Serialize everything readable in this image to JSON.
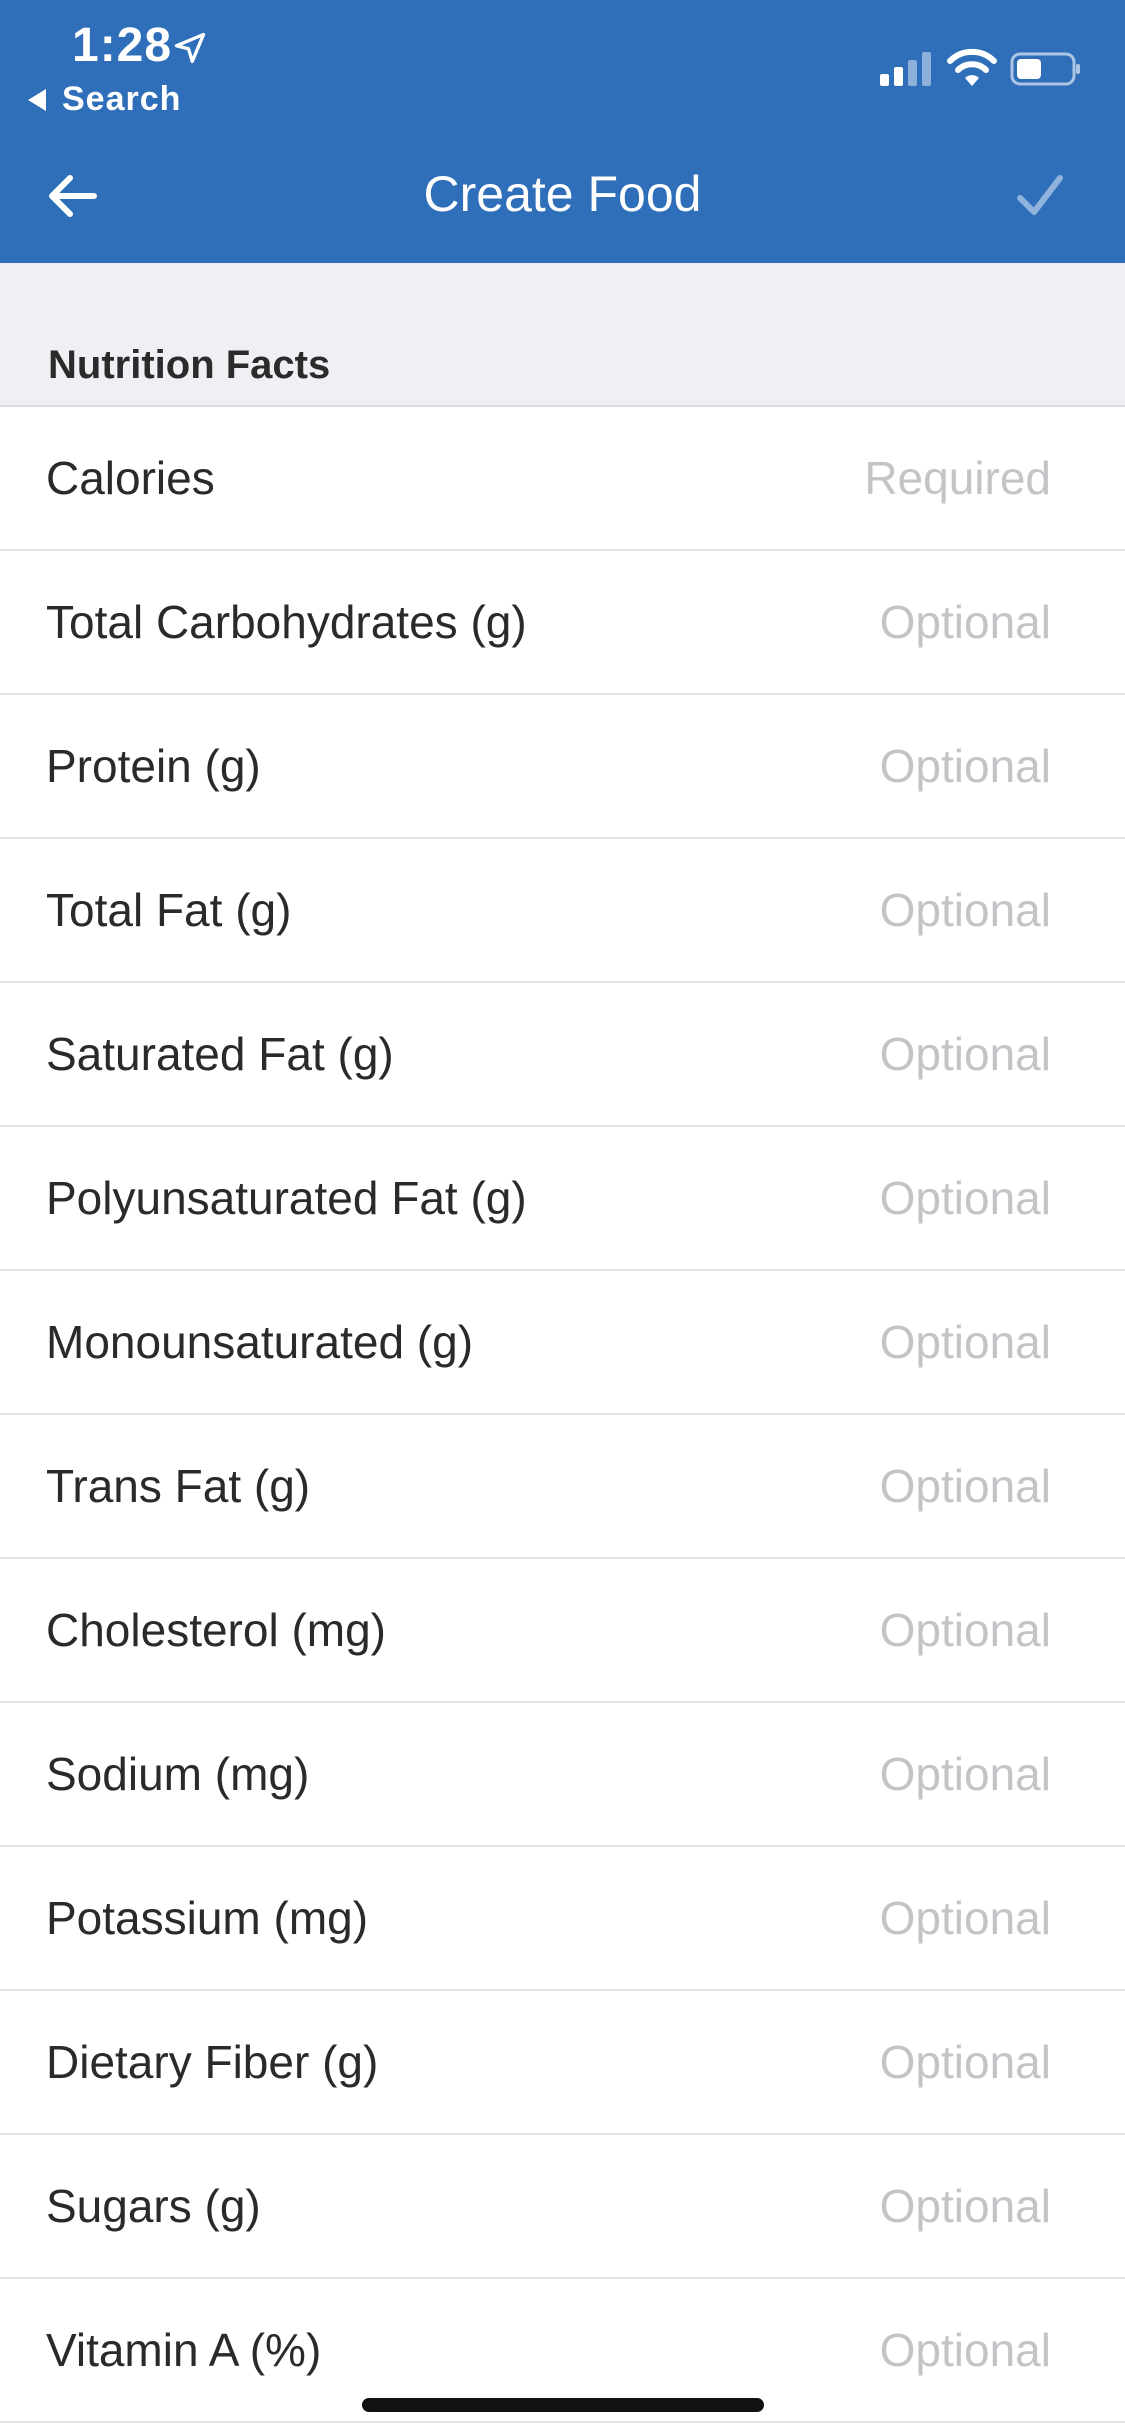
{
  "status_bar": {
    "time": "1:28",
    "back_app_label": "Search"
  },
  "nav": {
    "title": "Create Food"
  },
  "section": {
    "title": "Nutrition Facts"
  },
  "fields": [
    {
      "label": "Calories",
      "placeholder": "Required"
    },
    {
      "label": "Total Carbohydrates (g)",
      "placeholder": "Optional"
    },
    {
      "label": "Protein (g)",
      "placeholder": "Optional"
    },
    {
      "label": "Total Fat (g)",
      "placeholder": "Optional"
    },
    {
      "label": "Saturated Fat (g)",
      "placeholder": "Optional"
    },
    {
      "label": "Polyunsaturated Fat (g)",
      "placeholder": "Optional"
    },
    {
      "label": "Monounsaturated (g)",
      "placeholder": "Optional"
    },
    {
      "label": "Trans Fat (g)",
      "placeholder": "Optional"
    },
    {
      "label": "Cholesterol (mg)",
      "placeholder": "Optional"
    },
    {
      "label": "Sodium (mg)",
      "placeholder": "Optional"
    },
    {
      "label": "Potassium (mg)",
      "placeholder": "Optional"
    },
    {
      "label": "Dietary Fiber (g)",
      "placeholder": "Optional"
    },
    {
      "label": "Sugars (g)",
      "placeholder": "Optional"
    },
    {
      "label": "Vitamin A (%)",
      "placeholder": "Optional"
    }
  ],
  "colors": {
    "header_bg": "#2f6fba",
    "section_bg": "#efeff4",
    "placeholder": "#c4c4c8",
    "label_text": "#2a2a2a"
  },
  "icons": {
    "location": "location-arrow-icon",
    "signal": "cellular-signal-icon",
    "wifi": "wifi-icon",
    "battery": "battery-icon",
    "back": "arrow-left-icon",
    "save": "checkmark-icon"
  }
}
